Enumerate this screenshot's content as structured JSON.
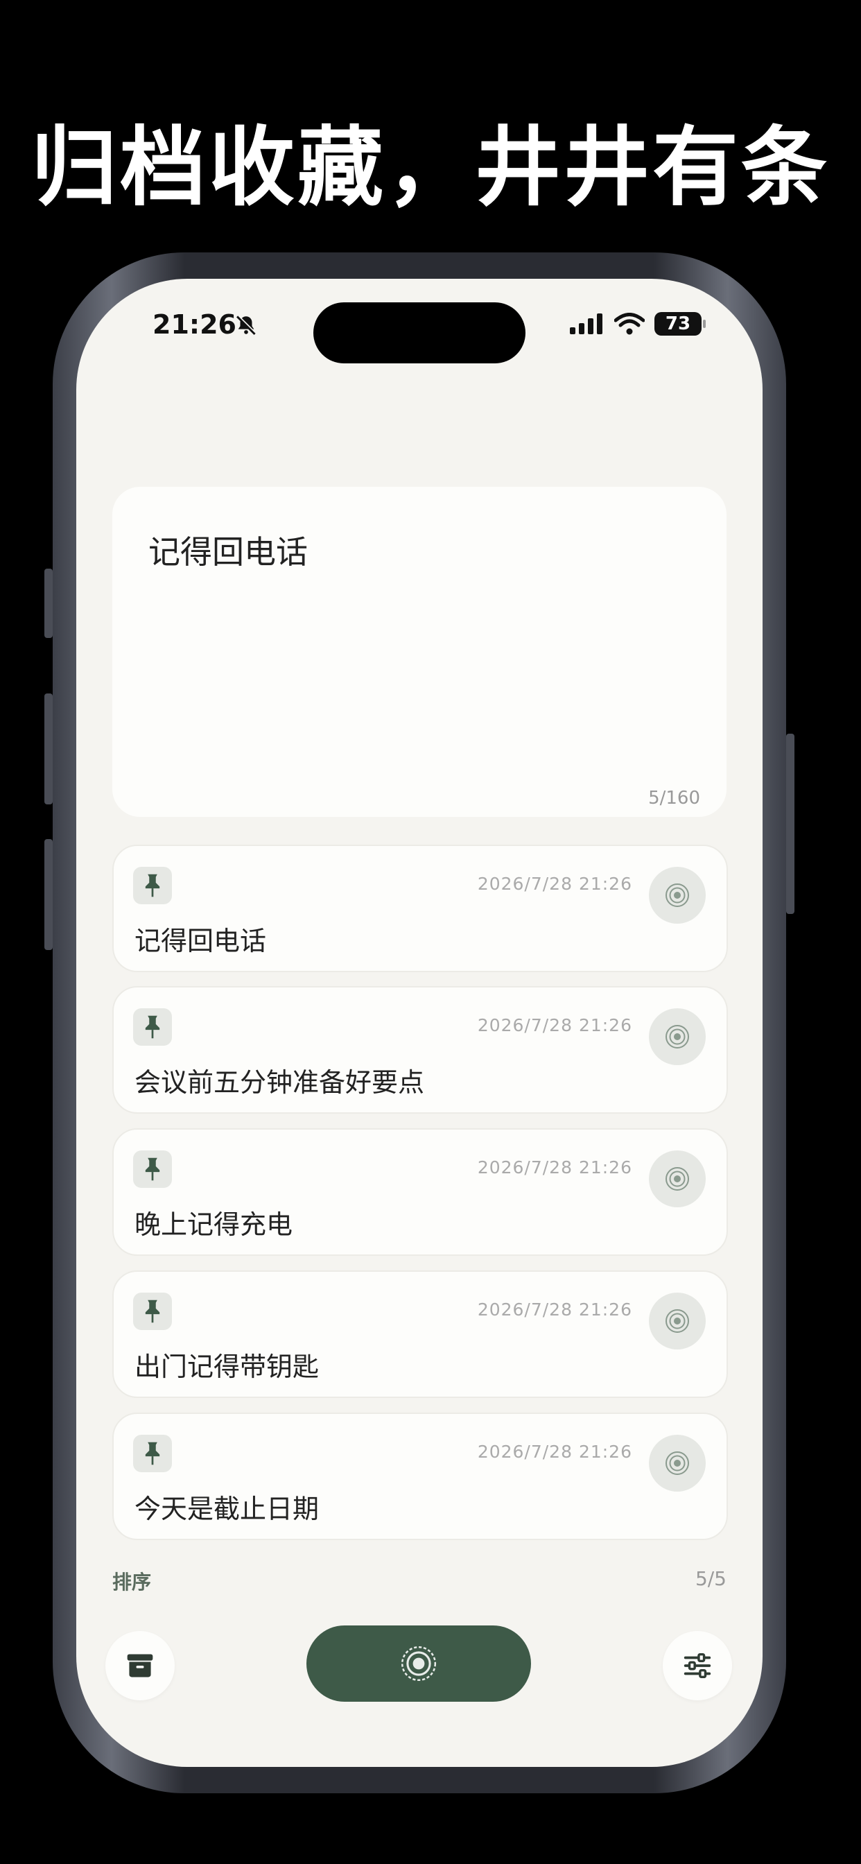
{
  "headline": "归档收藏，井井有条",
  "status": {
    "time": "21:26",
    "battery": "73"
  },
  "composer": {
    "text": "记得回电话",
    "count": "5/160"
  },
  "notes": [
    {
      "time": "2026/7/28 21:26",
      "text": "记得回电话"
    },
    {
      "time": "2026/7/28 21:26",
      "text": "会议前五分钟准备好要点"
    },
    {
      "time": "2026/7/28 21:26",
      "text": "晚上记得充电"
    },
    {
      "time": "2026/7/28 21:26",
      "text": "出门记得带钥匙"
    },
    {
      "time": "2026/7/28 21:26",
      "text": "今天是截止日期"
    }
  ],
  "footer": {
    "sort_label": "排序",
    "count": "5/5"
  },
  "icons": {
    "pin": "pin-icon",
    "record": "record-icon",
    "archive": "archive-icon",
    "filter": "sliders-icon"
  },
  "colors": {
    "accent": "#3e5a48",
    "background": "#f5f4f0",
    "card": "#fdfdfb"
  }
}
